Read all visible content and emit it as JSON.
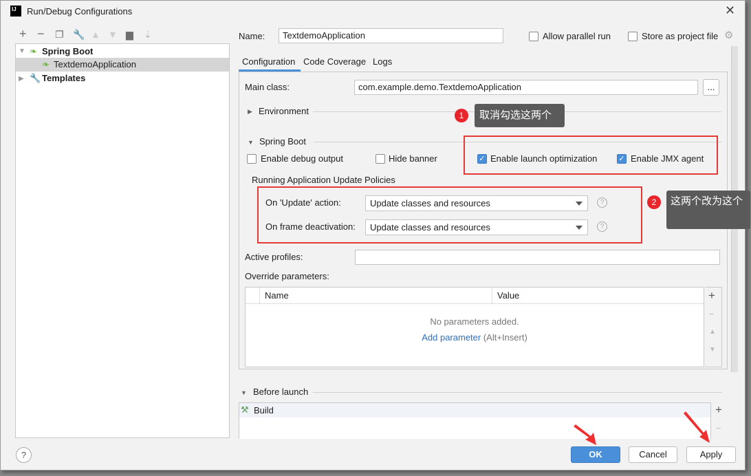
{
  "window": {
    "title": "Run/Debug Configurations",
    "app_icon": "IJ"
  },
  "toolbar": {
    "icons": [
      "plus-icon",
      "minus-icon",
      "copy-icon",
      "wrench-icon",
      "arrow-up-icon",
      "arrow-down-icon",
      "new-folder-icon",
      "sort-icon"
    ]
  },
  "tree": {
    "items": [
      {
        "label": "Spring Boot",
        "expanded": true
      },
      {
        "label": "TextdemoApplication",
        "selected": true
      },
      {
        "label": "Templates",
        "expanded": false
      }
    ]
  },
  "name": {
    "label": "Name:",
    "value": "TextdemoApplication"
  },
  "allow_parallel": {
    "label": "Allow parallel run",
    "checked": false
  },
  "store_project": {
    "label": "Store as project file",
    "checked": false
  },
  "tabs": [
    {
      "label": "Configuration",
      "active": true
    },
    {
      "label": "Code Coverage"
    },
    {
      "label": "Logs"
    }
  ],
  "main_class": {
    "label": "Main class:",
    "value": "com.example.demo.TextdemoApplication",
    "browse": "..."
  },
  "environment": {
    "label": "Environment"
  },
  "spring_boot": {
    "label": "Spring Boot",
    "debug_output": {
      "label": "Enable debug output",
      "checked": false
    },
    "hide_banner": {
      "label": "Hide banner",
      "checked": false
    },
    "launch_opt": {
      "label": "Enable launch optimization",
      "checked": true
    },
    "jmx": {
      "label": "Enable JMX agent",
      "checked": true
    }
  },
  "policies": {
    "title": "Running Application Update Policies",
    "update_label": "On 'Update' action:",
    "update_value": "Update classes and resources",
    "frame_label": "On frame deactivation:",
    "frame_value": "Update classes and resources"
  },
  "active_profiles": {
    "label": "Active profiles:",
    "value": ""
  },
  "override": {
    "label": "Override parameters:",
    "columns": [
      "Name",
      "Value"
    ],
    "empty": "No parameters added.",
    "add_link": "Add parameter",
    "add_hint": "(Alt+Insert)"
  },
  "before_launch": {
    "label": "Before launch",
    "items": [
      "Build"
    ]
  },
  "buttons": {
    "ok": "OK",
    "cancel": "Cancel",
    "apply": "Apply",
    "help": "?"
  },
  "annotations": [
    {
      "n": "1",
      "text": "取消勾选这两个"
    },
    {
      "n": "2",
      "text": "这两个改为这个"
    }
  ],
  "colors": {
    "accent": "#4a8fd9",
    "annotation_red": "#e53935"
  }
}
